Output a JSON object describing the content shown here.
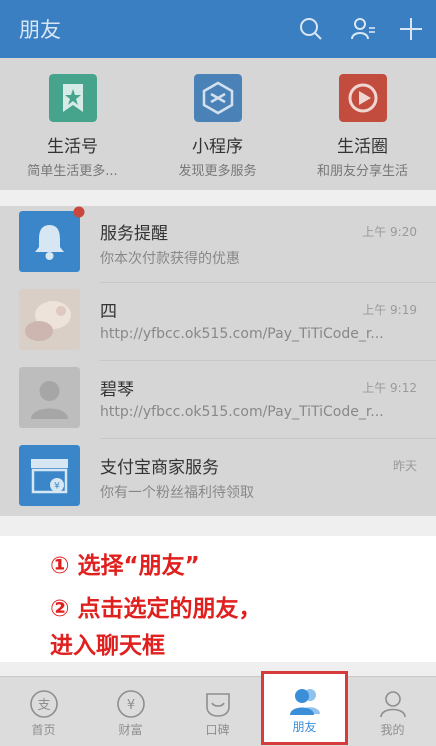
{
  "header": {
    "title": "朋友"
  },
  "quick_actions": [
    {
      "name": "生活号",
      "sub": "简单生活更多..."
    },
    {
      "name": "小程序",
      "sub": "发现更多服务"
    },
    {
      "name": "生活圈",
      "sub": "和朋友分享生活"
    }
  ],
  "messages": [
    {
      "name": "服务提醒",
      "sub": "你本次付款获得的优惠",
      "time": "上午 9:20"
    },
    {
      "name": "四",
      "sub": "http://yfbcc.ok515.com/Pay_TiTiCode_r...",
      "time": "上午 9:19"
    },
    {
      "name": "碧琴",
      "sub": "http://yfbcc.ok515.com/Pay_TiTiCode_r...",
      "time": "上午 9:12"
    },
    {
      "name": "支付宝商家服务",
      "sub": "你有一个粉丝福利待领取",
      "time": "昨天"
    }
  ],
  "overlay": {
    "line1": "① 选择“朋友”",
    "line2": "② 点击选定的朋友，",
    "line3": "进入聊天框"
  },
  "tabs": [
    {
      "label": "首页"
    },
    {
      "label": "财富"
    },
    {
      "label": "口碑"
    },
    {
      "label": "朋友"
    },
    {
      "label": "我的"
    }
  ],
  "colors": {
    "header": "#3a7fc2",
    "accent": "#3b8fd8",
    "annotation": "#e0201e"
  }
}
